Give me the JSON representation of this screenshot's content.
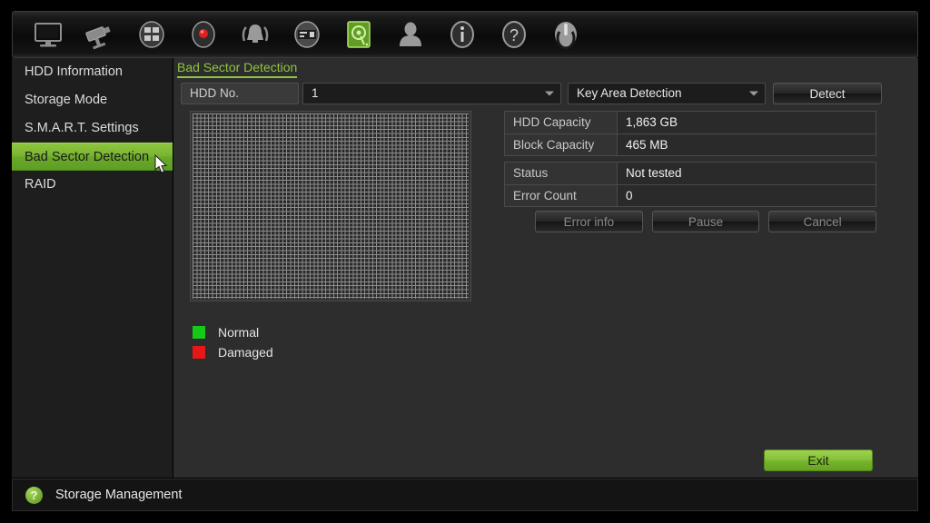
{
  "toolbar": {
    "items": [
      {
        "name": "monitor-icon",
        "label": "Display"
      },
      {
        "name": "camera-icon",
        "label": "Camera"
      },
      {
        "name": "network-icon",
        "label": "Network"
      },
      {
        "name": "record-icon",
        "label": "Record"
      },
      {
        "name": "alarm-bell-icon",
        "label": "Alarm"
      },
      {
        "name": "device-icon",
        "label": "Device"
      },
      {
        "name": "hdd-icon",
        "label": "HDD"
      },
      {
        "name": "user-icon",
        "label": "User"
      },
      {
        "name": "info-icon",
        "label": "Info"
      },
      {
        "name": "help-icon",
        "label": "Help"
      },
      {
        "name": "power-icon",
        "label": "Shutdown"
      }
    ],
    "active_index": 6
  },
  "sidebar": {
    "items": [
      {
        "label": "HDD Information",
        "selected": false
      },
      {
        "label": "Storage Mode",
        "selected": false
      },
      {
        "label": "S.M.A.R.T. Settings",
        "selected": false
      },
      {
        "label": "Bad Sector Detection",
        "selected": true
      },
      {
        "label": "RAID",
        "selected": false
      }
    ]
  },
  "main": {
    "title": "Bad Sector Detection",
    "hdd_label": "HDD No.",
    "hdd_value": "1",
    "detection_type_value": "Key Area Detection",
    "detect_button": "Detect",
    "info": {
      "capacity_rows": [
        {
          "key": "HDD Capacity",
          "value": "1,863 GB"
        },
        {
          "key": "Block Capacity",
          "value": "465 MB"
        }
      ],
      "status_rows": [
        {
          "key": "Status",
          "value": "Not tested"
        },
        {
          "key": "Error Count",
          "value": "0"
        }
      ]
    },
    "actions": [
      {
        "label": "Error info",
        "disabled": true
      },
      {
        "label": "Pause",
        "disabled": true
      },
      {
        "label": "Cancel",
        "disabled": true
      }
    ],
    "legend": [
      {
        "label": "Normal",
        "color": "#16c916"
      },
      {
        "label": "Damaged",
        "color": "#e81717"
      }
    ],
    "exit_button": "Exit"
  },
  "statusbar": {
    "help_glyph": "?",
    "label": "Storage Management"
  },
  "colors": {
    "accent_green": "#8dc63f",
    "normal": "#16c916",
    "damaged": "#e81717",
    "panel_bg": "#2d2d2d",
    "sidebar_bg": "#1e1e1e"
  }
}
